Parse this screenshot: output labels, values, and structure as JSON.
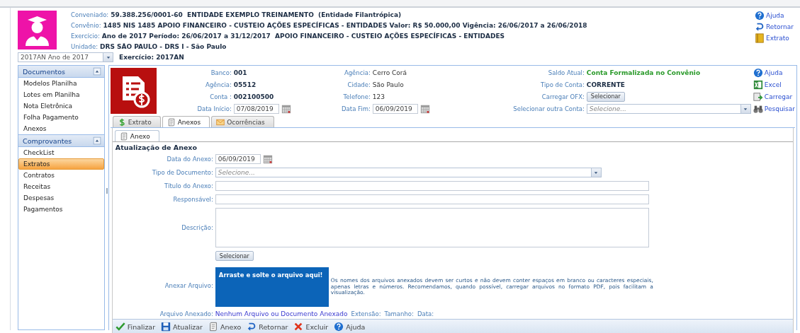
{
  "header": {
    "lines": [
      {
        "label": "Conveniado:",
        "value": "59.388.256/0001-60  ENTIDADE EXEMPLO TREINAMENTO  (Entidade Filantrópica)"
      },
      {
        "label": "Convênio:",
        "value": "1485 NIS 1485 APOIO FINANCEIRO - CUSTEIO AÇÕES ESPECÍFICAS - ENTIDADES Valor: R$ 50.000,00 Vigência: 26/06/2017 a 26/06/2018"
      },
      {
        "label": "Exercício:",
        "value": "Ano de 2017 Período: 26/06/2017 a 31/12/2017  APOIO FINANCEIRO - CUSTEIO AÇÕES ESPECÍFICAS - ENTIDADES"
      },
      {
        "label": "Unidade:",
        "value": "DRS SÃO PAULO - DRS I - São Paulo"
      }
    ],
    "links": [
      {
        "label": "Ajuda",
        "kind": "help"
      },
      {
        "label": "Retornar",
        "kind": "return"
      },
      {
        "label": "Extrato",
        "kind": "book"
      }
    ]
  },
  "year_select": {
    "value": "2017AN Ano de 2017"
  },
  "exercise": "Exercício: 2017AN",
  "sidebar": [
    {
      "title": "Documentos",
      "items": [
        {
          "label": "Modelos Planilha",
          "selected": false
        },
        {
          "label": "Lotes em Planilha",
          "selected": false
        },
        {
          "label": "Nota Eletrônica",
          "selected": false
        },
        {
          "label": "Folha Pagamento",
          "selected": false
        },
        {
          "label": "Anexos",
          "selected": false
        }
      ]
    },
    {
      "title": "Comprovantes",
      "items": [
        {
          "label": "CheckList",
          "selected": false
        },
        {
          "label": "Extratos",
          "selected": true
        },
        {
          "label": "Contratos",
          "selected": false
        },
        {
          "label": "Receitas",
          "selected": false
        },
        {
          "label": "Despesas",
          "selected": false
        },
        {
          "label": "Pagamentos",
          "selected": false
        }
      ]
    }
  ],
  "account": {
    "rows": [
      {
        "cells": [
          {
            "label": "Banco:",
            "value": "001",
            "kind": "bold"
          },
          {
            "label": "Agência:",
            "value": "Cerro Corá",
            "kind": "text"
          },
          {
            "label": "Saldo Atual:",
            "value": "Conta Formalizada no Convênio",
            "kind": "status"
          }
        ],
        "link": {
          "label": "Ajuda",
          "kind": "help"
        }
      },
      {
        "cells": [
          {
            "label": "Agência:",
            "value": "05512",
            "kind": "bold"
          },
          {
            "label": "Cidade:",
            "value": "São Paulo",
            "kind": "text"
          },
          {
            "label": "Tipo de Conta:",
            "value": "CORRENTE",
            "kind": "bold"
          }
        ],
        "link": {
          "label": "Excel",
          "kind": "excel"
        }
      },
      {
        "cells": [
          {
            "label": "Conta :",
            "value": "002100500",
            "kind": "bold"
          },
          {
            "label": "Telefone:",
            "value": "123",
            "kind": "text"
          },
          {
            "label": "Carregar OFX:",
            "value": "Selecionar",
            "kind": "button"
          }
        ],
        "link": {
          "label": "Carregar",
          "kind": "upload"
        }
      },
      {
        "cells": [
          {
            "label": "Data Início:",
            "value": "07/08/2019",
            "kind": "date"
          },
          {
            "label": "Data Fim:",
            "value": "06/09/2019",
            "kind": "date"
          },
          {
            "label": "Selecionar outra Conta:",
            "placeholder": "Selecione...",
            "kind": "select"
          }
        ],
        "link": {
          "label": "Pesquisar",
          "kind": "binoculars"
        }
      }
    ]
  },
  "tabs": [
    {
      "label": "Extrato",
      "kind": "dollar",
      "selected": false
    },
    {
      "label": "Anexos",
      "kind": "doc",
      "selected": true
    },
    {
      "label": "Ocorrências",
      "kind": "envelope",
      "selected": false
    }
  ],
  "subtab": {
    "label": "Anexo",
    "kind": "doc",
    "selected": true
  },
  "form": {
    "title": "Atualização de Anexo",
    "fields": [
      {
        "label": "Data do Anexo:",
        "kind": "date",
        "value": "06/09/2019"
      },
      {
        "label": "Tipo de Documento:",
        "kind": "select",
        "placeholder": "Selecione..."
      },
      {
        "label": "Título do Anexo:",
        "kind": "input"
      },
      {
        "label": "Responsável:",
        "kind": "input"
      },
      {
        "label": "Descrição:",
        "kind": "textarea"
      }
    ],
    "select_button": "Selecionar",
    "attach": {
      "label": "Anexar Arquivo:",
      "dropzone": "Arraste e solte o arquivo aqui!",
      "help": "Os nomes dos arquivos anexados devem ser curtos e não devem conter espaços em branco ou caracteres especiais, apenas letras e números. Recomendamos, quando possível, carregar arquivos no formato PDF, pois facilitam a visualização."
    },
    "attached": {
      "label": "Arquivo Anexado:",
      "value": "Nenhum Arquivo ou Documento Anexado",
      "extras": [
        "Extensão:",
        "Tamanho:",
        "Data:"
      ]
    }
  },
  "toolbar": [
    {
      "label": "Finalizar",
      "kind": "check"
    },
    {
      "label": "Atualizar",
      "kind": "save"
    },
    {
      "label": "Anexo",
      "kind": "doc"
    },
    {
      "label": "Retornar",
      "kind": "return"
    },
    {
      "label": "Excluir",
      "kind": "delete"
    },
    {
      "label": "Ajuda",
      "kind": "help"
    }
  ]
}
